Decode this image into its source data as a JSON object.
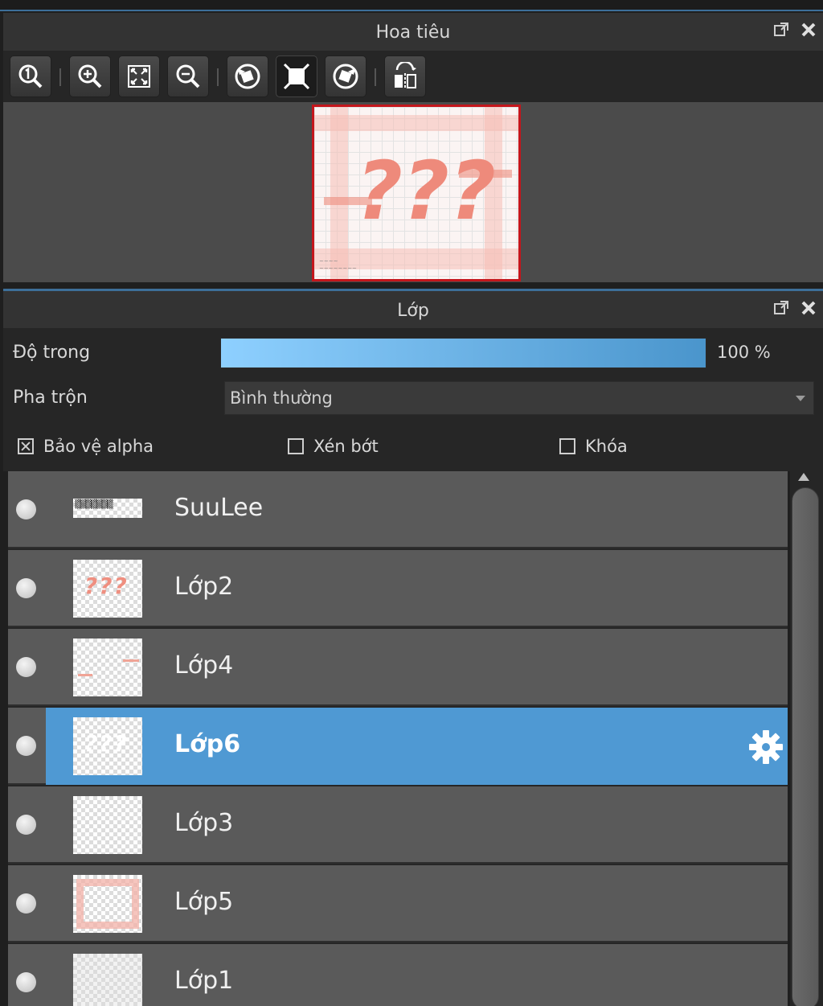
{
  "navigator": {
    "title": "Hoa tiêu",
    "toolbar": [
      {
        "name": "zoom-actual-size-icon"
      },
      {
        "name": "zoom-in-icon"
      },
      {
        "name": "fit-to-window-icon"
      },
      {
        "name": "zoom-out-icon"
      },
      {
        "name": "rotate-left-icon"
      },
      {
        "name": "reset-view-icon"
      },
      {
        "name": "rotate-right-icon"
      },
      {
        "name": "flip-horizontal-icon"
      }
    ]
  },
  "layers_panel": {
    "title": "Lớp",
    "opacity_label": "Độ trong",
    "opacity_value": "100 %",
    "opacity_fraction": 1.0,
    "blend_label": "Pha trộn",
    "blend_value": "Bình thường",
    "checkboxes": [
      {
        "label": "Bảo vệ alpha",
        "checked": true
      },
      {
        "label": "Xén bớt",
        "checked": false
      },
      {
        "label": "Khóa",
        "checked": false
      }
    ],
    "layers": [
      {
        "name": "SuuLee",
        "selected": false
      },
      {
        "name": "Lớp2",
        "selected": false
      },
      {
        "name": "Lớp4",
        "selected": false
      },
      {
        "name": "Lớp6",
        "selected": true
      },
      {
        "name": "Lớp3",
        "selected": false
      },
      {
        "name": "Lớp5",
        "selected": false
      },
      {
        "name": "Lớp1",
        "selected": false
      }
    ]
  },
  "colors": {
    "accent": "#4f99d3",
    "preview_border": "#c4161c"
  }
}
